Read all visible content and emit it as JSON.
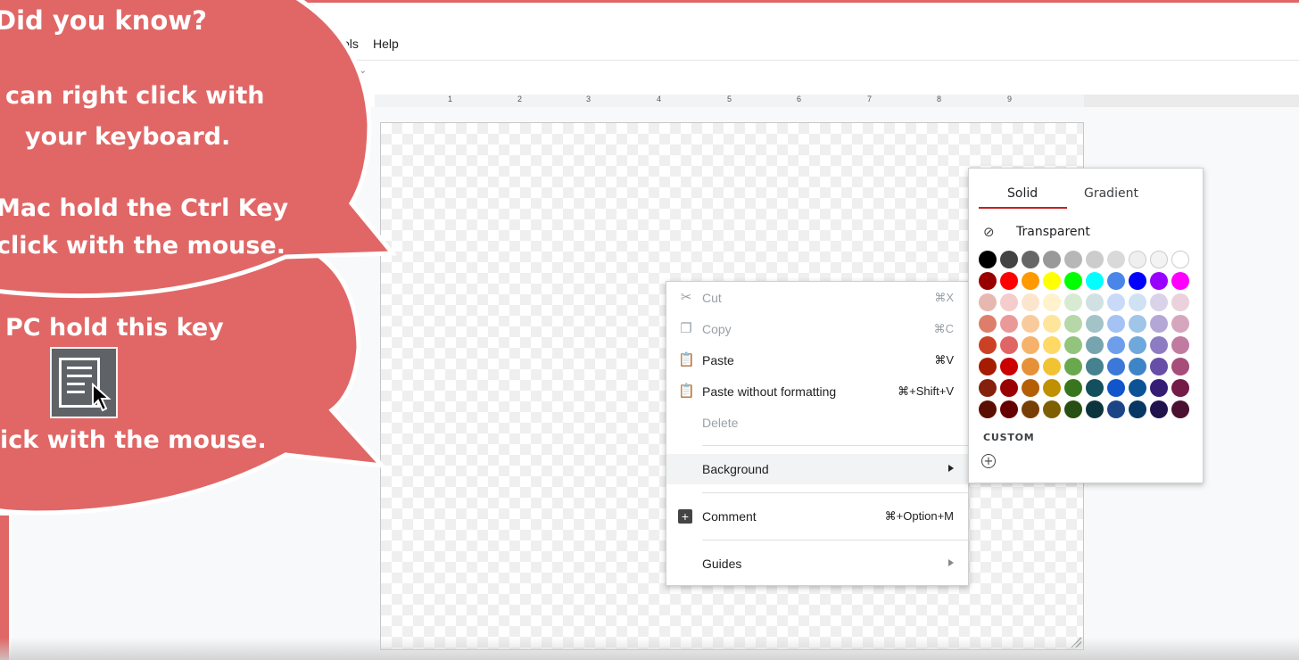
{
  "menubar": {
    "items": [
      "ols",
      "Help"
    ]
  },
  "ruler": {
    "numbers": [
      "1",
      "2",
      "3",
      "4",
      "5",
      "6",
      "7",
      "8",
      "9"
    ]
  },
  "context_menu": {
    "items": [
      {
        "label": "Cut",
        "shortcut": "⌘X",
        "icon": "scissors-icon",
        "enabled": false
      },
      {
        "label": "Copy",
        "shortcut": "⌘C",
        "icon": "copy-icon",
        "enabled": false
      },
      {
        "label": "Paste",
        "shortcut": "⌘V",
        "icon": "clipboard-icon",
        "enabled": true
      },
      {
        "label": "Paste without formatting",
        "shortcut": "⌘+Shift+V",
        "icon": "clipboard-text-icon",
        "enabled": true
      },
      {
        "label": "Delete",
        "shortcut": "",
        "enabled": false
      },
      {
        "label": "Background",
        "shortcut": "",
        "submenu": true,
        "highlighted": true
      },
      {
        "label": "Comment",
        "shortcut": "⌘+Option+M",
        "icon": "add-comment-icon",
        "enabled": true
      },
      {
        "label": "Guides",
        "shortcut": "",
        "submenu": true
      }
    ]
  },
  "palette": {
    "tabs": [
      "Solid",
      "Gradient"
    ],
    "active_tab": "Solid",
    "transparent_label": "Transparent",
    "custom_label": "CUSTOM",
    "rows": [
      [
        "#000000",
        "#434343",
        "#666666",
        "#999999",
        "#b7b7b7",
        "#cccccc",
        "#d9d9d9",
        "#efefef",
        "#f3f3f3",
        "#ffffff"
      ],
      [
        "#980000",
        "#ff0000",
        "#ff9900",
        "#ffff00",
        "#00ff00",
        "#00ffff",
        "#4a86e8",
        "#0000ff",
        "#9900ff",
        "#ff00ff"
      ],
      [
        "#e6b8af",
        "#f4cccc",
        "#fce5cd",
        "#fff2cc",
        "#d9ead3",
        "#d0e0e3",
        "#c9daf8",
        "#cfe2f3",
        "#d9d2e9",
        "#ead1dc"
      ],
      [
        "#dd7e6b",
        "#ea9999",
        "#f9cb9c",
        "#ffe599",
        "#b6d7a8",
        "#a2c4c9",
        "#a4c2f4",
        "#9fc5e8",
        "#b4a7d6",
        "#d5a6bd"
      ],
      [
        "#cc4125",
        "#e06666",
        "#f6b26b",
        "#ffd966",
        "#93c47d",
        "#76a5af",
        "#6d9eeb",
        "#6fa8dc",
        "#8e7cc3",
        "#c27ba0"
      ],
      [
        "#a61c00",
        "#cc0000",
        "#e69138",
        "#f1c232",
        "#6aa84f",
        "#45818e",
        "#3c78d8",
        "#3d85c6",
        "#674ea7",
        "#a64d79"
      ],
      [
        "#85200c",
        "#990000",
        "#b45f06",
        "#bf9000",
        "#38761d",
        "#134f5c",
        "#1155cc",
        "#0b5394",
        "#351c75",
        "#741b47"
      ],
      [
        "#5b0f00",
        "#660000",
        "#783f04",
        "#7f6000",
        "#274e13",
        "#0c343d",
        "#1c4587",
        "#073763",
        "#20124d",
        "#4c1130"
      ]
    ]
  },
  "callouts": {
    "title": "Did you know?",
    "line1": "can right click with",
    "line2": "your keyboard.",
    "line3": "Mac hold the Ctrl Key",
    "line4": "click with the mouse.",
    "line5": "PC hold this key",
    "line6": "ick with the mouse."
  },
  "colors": {
    "bubble": "#e06766",
    "accent_red": "#c5221f"
  }
}
